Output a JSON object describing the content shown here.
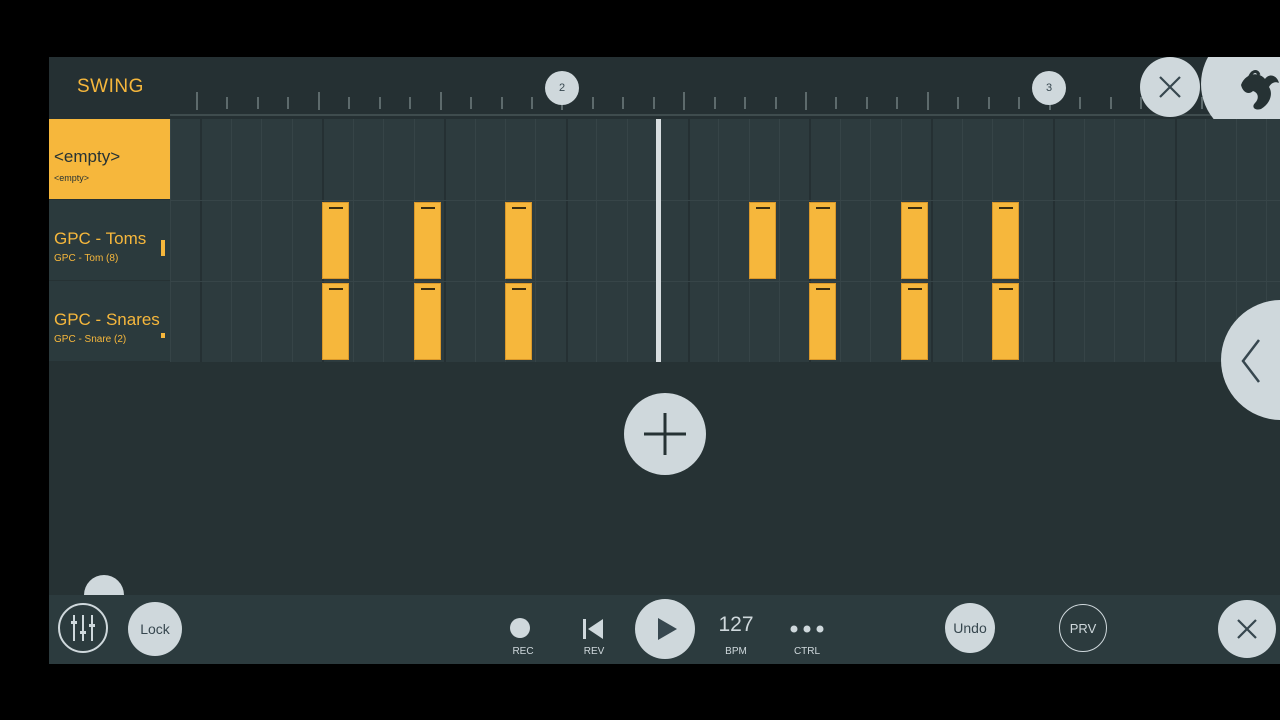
{
  "header": {
    "swing_label": "SWING",
    "bar_markers": [
      "2",
      "3"
    ]
  },
  "channels": [
    {
      "name": "<empty>",
      "sub": "<empty>",
      "selected": true
    },
    {
      "name": "GPC - Toms",
      "sub": "GPC - Tom (8)",
      "selected": false
    },
    {
      "name": "GPC - Snares",
      "sub": "GPC - Snare (2)",
      "selected": false
    }
  ],
  "pattern": {
    "steps_per_row": 32,
    "notes": [
      {
        "channel": 1,
        "steps": [
          5,
          8,
          11,
          19,
          21,
          24,
          27
        ]
      },
      {
        "channel": 2,
        "steps": [
          5,
          8,
          11,
          21,
          24,
          27
        ]
      }
    ]
  },
  "transport": {
    "lock_label": "Lock",
    "rec_label": "REC",
    "rev_label": "REV",
    "bpm_value": "127",
    "bpm_label": "BPM",
    "ctrl_label": "CTRL",
    "undo_label": "Undo",
    "prv_label": "PRV"
  },
  "colors": {
    "accent": "#f6b73c",
    "background": "#263234",
    "button": "#cfd8dc"
  },
  "icons": [
    "close-icon",
    "fl-logo-icon",
    "add-icon",
    "chevron-left-icon",
    "mixer-icon",
    "record-icon",
    "rewind-icon",
    "play-icon",
    "more-icon",
    "close-icon"
  ]
}
